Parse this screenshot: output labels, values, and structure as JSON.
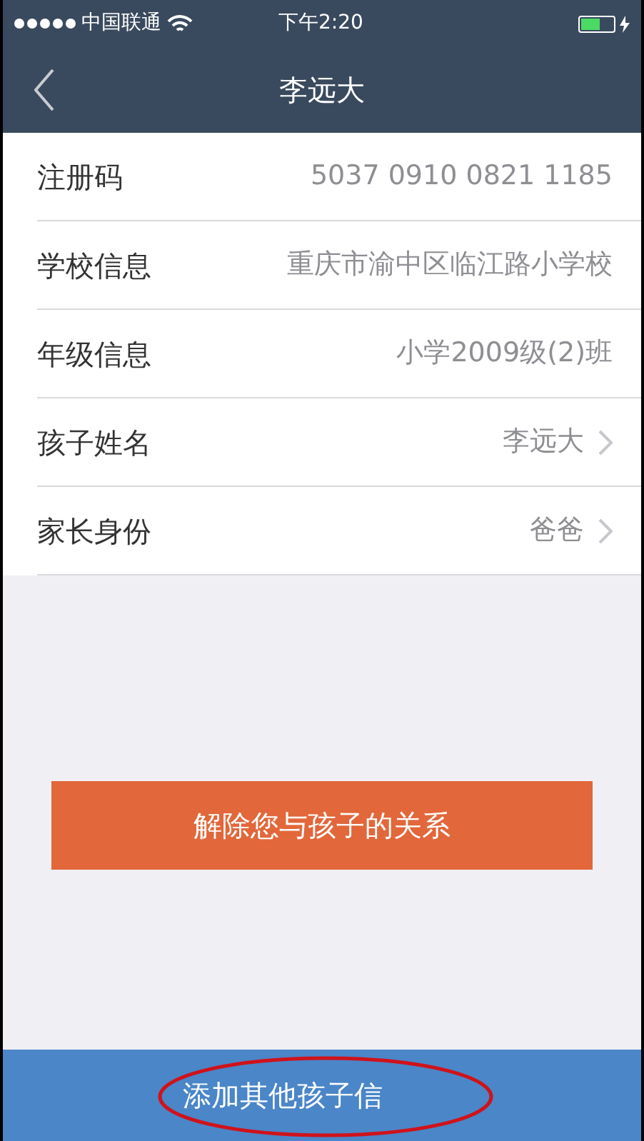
{
  "status_bar": {
    "carrier": "中国联通",
    "time": "下午2:20",
    "battery": {
      "level": 0.6
    }
  },
  "nav": {
    "title": "李远大"
  },
  "rows": [
    {
      "label": "注册码",
      "value": "5037 0910 0821 1185",
      "chevron": false
    },
    {
      "label": "学校信息",
      "value": "重庆市渝中区临江路小学校",
      "chevron": false
    },
    {
      "label": "年级信息",
      "value": "小学2009级(2)班",
      "chevron": false
    },
    {
      "label": "孩子姓名",
      "value": "李远大",
      "chevron": true
    },
    {
      "label": "家长身份",
      "value": "爸爸",
      "chevron": true
    }
  ],
  "unbind_button": "解除您与孩子的关系",
  "bottom_button": "添加其他孩子信"
}
